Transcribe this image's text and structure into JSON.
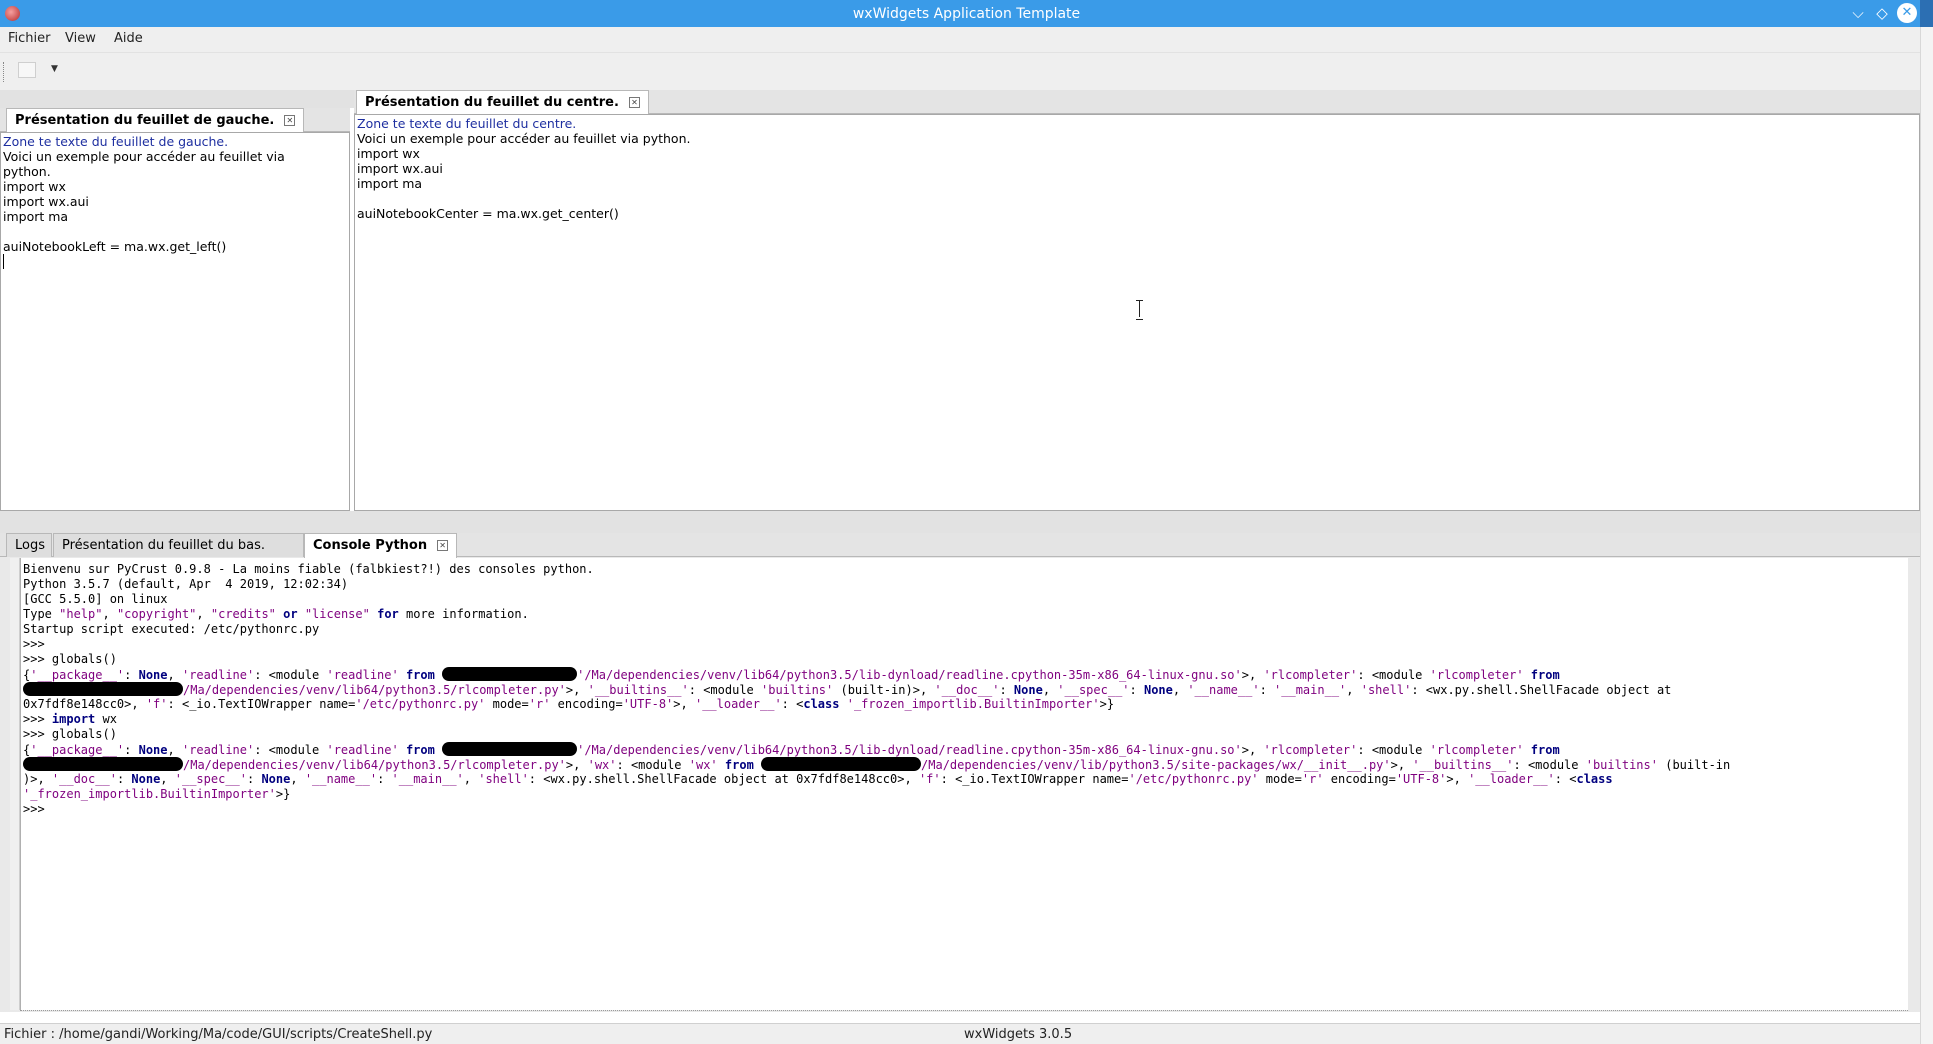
{
  "window": {
    "title": "wxWidgets Application Template",
    "controls": {
      "minimize": "⌵",
      "maximize": "◇",
      "close": "✕"
    }
  },
  "menubar": {
    "items": [
      "Fichier",
      "View",
      "Aide"
    ]
  },
  "toolbar": {
    "dropdown_glyph": "▼"
  },
  "left_notebook": {
    "tab_label": "Présentation du feuillet de gauche.",
    "lines": [
      "Zone te texte du feuillet de gauche.",
      "Voici un exemple pour accéder au feuillet via",
      "python.",
      "import wx",
      "import wx.aui",
      "import ma",
      "",
      "auiNotebookLeft = ma.wx.get_left()"
    ]
  },
  "center_notebook": {
    "tab_label": "Présentation du feuillet du centre.",
    "lines": [
      "Zone te texte du feuillet du centre.",
      "Voici un exemple pour accéder au feuillet via python.",
      "import wx",
      "import wx.aui",
      "import ma",
      "",
      "auiNotebookCenter = ma.wx.get_center()"
    ]
  },
  "bottom_notebook": {
    "tabs": [
      "Logs",
      "Présentation du feuillet du bas.",
      "Console Python"
    ],
    "active_tab": "Console Python"
  },
  "console": {
    "banner": [
      "Bienvenu sur PyCrust 0.9.8 - La moins fiable (falbkiest?!) des consoles python.",
      "Python 3.5.7 (default, Apr  4 2019, 12:02:34)",
      "[GCC 5.5.0] on linux"
    ],
    "help_line": {
      "prefix": "Type ",
      "help": "\"help\"",
      "copyright": "\"copyright\"",
      "credits": "\"credits\"",
      "or": "or",
      "license": "\"license\"",
      "for": "for",
      "suffix": " more information."
    },
    "startup": "Startup script executed: /etc/pythonrc.py",
    "prompt": ">>>",
    "cmd_globals": "globals()",
    "cmd_import": "import",
    "cmd_import_mod": "wx",
    "tok": {
      "brace_open": "{",
      "package_key": "'__package__'",
      "none": "None",
      "readline_key": "'readline'",
      "module_open": "<module ",
      "readline_mod": "'readline'",
      "from": "from",
      "readline_path": "'/Ma/dependencies/venv/lib64/python3.5/lib-dynload/readline.cpython-35m-x86_64-linux-gnu.so'",
      "rlcompleter_key": "'rlcompleter'",
      "rlcompleter_mod": "'rlcompleter'",
      "rlcompleter_path": "/Ma/dependencies/venv/lib64/python3.5/rlcompleter.py'",
      "builtins_key": "'__builtins__'",
      "builtins_mod": "'builtins'",
      "builtin_in": "(built-in)",
      "builtin_in_trunc": "(built-in",
      "doc_key": "'__doc__'",
      "spec_key": "'__spec__'",
      "name_key": "'__name__'",
      "main_val": "'__main__'",
      "shell_key": "'shell'",
      "shell_val_1": "<wx.py.shell.ShellFacade object at",
      "shell_val_full": "<wx.py.shell.ShellFacade object at 0x7fdf8e148cc0>",
      "addr_end": "0x7fdf8e148cc0>",
      "f_key": "'f'",
      "textio": "<_io.TextIOWrapper name=",
      "pythonrc": "'/etc/pythonrc.py'",
      "mode_eq": " mode=",
      "mode_r": "'r'",
      "enc_eq": " encoding=",
      "utf8": "'UTF-8'",
      "loader_key": "'__loader__'",
      "class_kw": "class",
      "importer": "'_frozen_importlib.BuiltinImporter'",
      "importer_wrapped": "'_frozen_importlib.BuiltinImporter'",
      "wx_key": "'wx'",
      "wx_mod": "'wx'",
      "wx_path": "/Ma/dependencies/venv/lib/python3.5/site-packages/wx/__init__.py'"
    }
  },
  "statusbar": {
    "file": "Fichier : /home/gandi/Working/Ma/code/GUI/scripts/CreateShell.py",
    "version": "wxWidgets 3.0.5"
  }
}
